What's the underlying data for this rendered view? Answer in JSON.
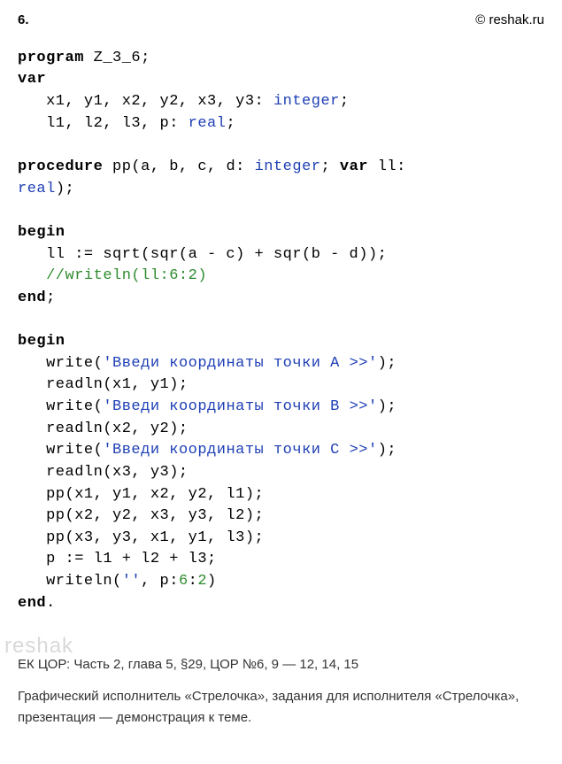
{
  "header": {
    "exercise_number": "6.",
    "site": "© reshak.ru"
  },
  "code": {
    "l1_kw1": "program",
    "l1_name": " Z_3_6;",
    "l2_kw": "var",
    "l3_pre": "   x1, y1, x2, y2, x3, y3: ",
    "l3_type": "integer",
    "l3_post": ";",
    "l4_pre": "   l1, l2, l3, p: ",
    "l4_type": "real",
    "l4_post": ";",
    "l6_kw": "procedure",
    "l6_mid": " pp(a, b, c, d: ",
    "l6_type1": "integer",
    "l6_mid2": "; ",
    "l6_kw2": "var",
    "l6_mid3": " ll:",
    "l7_type": "real",
    "l7_post": ");",
    "l9_kw": "begin",
    "l10": "   ll := sqrt(sqr(a - c) + sqr(b - d));",
    "l11_comment": "   //writeln(ll:6:2)",
    "l12_kw": "end",
    "l12_post": ";",
    "l14_kw": "begin",
    "l15_pre": "   write(",
    "l15_str": "'Введи координаты точки A >>'",
    "l15_post": ");",
    "l16": "   readln(x1, y1);",
    "l17_pre": "   write(",
    "l17_str": "'Введи координаты точки B >>'",
    "l17_post": ");",
    "l18": "   readln(x2, y2);",
    "l19_pre": "   write(",
    "l19_str": "'Введи координаты точки C >>'",
    "l19_post": ");",
    "l20": "   readln(x3, y3);",
    "l21": "   pp(x1, y1, x2, y2, l1);",
    "l22": "   pp(x2, y2, x3, y3, l2);",
    "l23": "   pp(x3, y3, x1, y1, l3);",
    "l24": "   p := l1 + l2 + l3;",
    "l25_pre": "   writeln(",
    "l25_str": "''",
    "l25_mid": ", p:",
    "l25_n1": "6",
    "l25_mid2": ":",
    "l25_n2": "2",
    "l25_post": ")",
    "l26_kw": "end",
    "l26_post": "."
  },
  "footer": {
    "line1": "ЕК ЦОР: Часть 2, глава 5, §29, ЦОР №6, 9 — 12, 14, 15",
    "line2": "Графический исполнитель «Стрелочка», задания для исполнителя «Стрелочка», презентация — демонстрация к теме."
  },
  "watermark": "reshak"
}
